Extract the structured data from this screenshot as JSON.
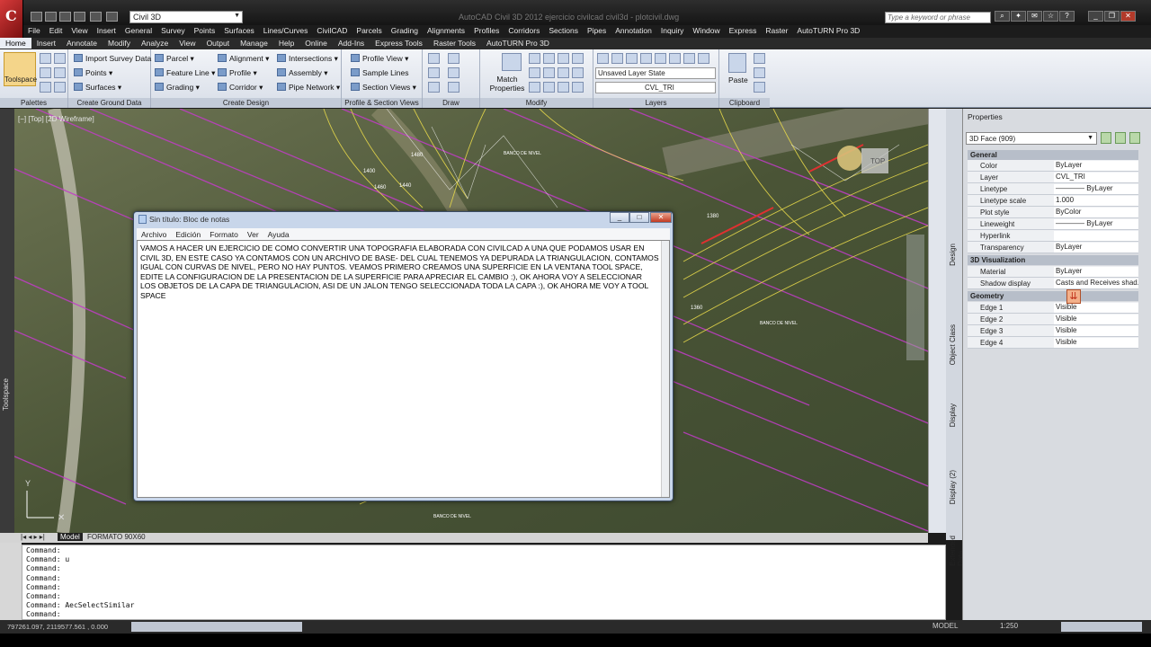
{
  "app": {
    "workspace": "Civil 3D",
    "title": "AutoCAD Civil 3D 2012    ejercicio civilcad civil3d - plotcivil.dwg",
    "search_placeholder": "Type a keyword or phrase"
  },
  "menu": [
    "File",
    "Edit",
    "View",
    "Insert",
    "General",
    "Survey",
    "Points",
    "Surfaces",
    "Lines/Curves",
    "CivilCAD",
    "Parcels",
    "Grading",
    "Alignments",
    "Profiles",
    "Corridors",
    "Sections",
    "Pipes",
    "Annotation",
    "Inquiry",
    "Window",
    "Express",
    "Raster",
    "AutoTURN Pro 3D"
  ],
  "tabs": [
    "Home",
    "Insert",
    "Annotate",
    "Modify",
    "Analyze",
    "View",
    "Output",
    "Manage",
    "Help",
    "Online",
    "Add-Ins",
    "Express Tools",
    "Raster Tools",
    "AutoTURN Pro 3D"
  ],
  "ribbon": {
    "toolspace": "Toolspace",
    "import_survey": "Import Survey Data",
    "points": "Points",
    "surfaces": "Surfaces",
    "parcel": "Parcel",
    "feature_line": "Feature Line",
    "grading": "Grading",
    "alignment": "Alignment",
    "profile": "Profile",
    "corridor": "Corridor",
    "intersections": "Intersections",
    "assembly": "Assembly",
    "pipe_network": "Pipe Network",
    "profile_view": "Profile View",
    "sample_lines": "Sample Lines",
    "section_views": "Section Views",
    "match_properties": "Match Properties",
    "layer_state": "Unsaved Layer State",
    "layer_current": "CVL_TRI",
    "paste": "Paste",
    "panels": [
      "Palettes",
      "Create Ground Data",
      "Create Design",
      "Profile & Section Views",
      "Draw",
      "Modify",
      "Layers",
      "Clipboard"
    ]
  },
  "viewport": {
    "label": "[−] [Top] [2D Wireframe]",
    "nav_top": "TOP",
    "contour_labels": [
      "1480",
      "1460",
      "1440",
      "1400",
      "1380",
      "1360"
    ],
    "level_note": "BANCO DE NIVEL"
  },
  "toolspace_label": "Toolspace",
  "model_tabs": [
    "Model",
    "FORMATO 90X60"
  ],
  "command_lines": [
    "Command:",
    "Command: u",
    "Command:",
    "Command:",
    "Command:",
    "Command:",
    "Command: AecSelectSimilar",
    "Command:"
  ],
  "status": {
    "coords": "797261.097, 2119577.561 , 0.000",
    "model": "MODEL",
    "scale": "1:250"
  },
  "palette_tabs": [
    "Design",
    "Object Class",
    "Display",
    "Display (2)",
    "Extended Data"
  ],
  "properties": {
    "title": "Properties",
    "selection": "3D Face (909)",
    "sections": [
      {
        "name": "General",
        "rows": [
          [
            "Color",
            "ByLayer"
          ],
          [
            "Layer",
            "CVL_TRI"
          ],
          [
            "Linetype",
            "———— ByLayer"
          ],
          [
            "Linetype scale",
            "1.000"
          ],
          [
            "Plot style",
            "ByColor"
          ],
          [
            "Lineweight",
            "———— ByLayer"
          ],
          [
            "Hyperlink",
            ""
          ],
          [
            "Transparency",
            "ByLayer"
          ]
        ]
      },
      {
        "name": "3D Visualization",
        "rows": [
          [
            "Material",
            "ByLayer"
          ],
          [
            "Shadow display",
            "Casts and Receives shad..."
          ]
        ]
      },
      {
        "name": "Geometry",
        "rows": [
          [
            "Edge 1",
            "Visible"
          ],
          [
            "Edge 2",
            "Visible"
          ],
          [
            "Edge 3",
            "Visible"
          ],
          [
            "Edge 4",
            "Visible"
          ]
        ]
      }
    ]
  },
  "notepad": {
    "title": "Sin título: Bloc de notas",
    "menu": [
      "Archivo",
      "Edición",
      "Formato",
      "Ver",
      "Ayuda"
    ],
    "text": "VAMOS A HACER UN EJERCICIO DE COMO CONVERTIR UNA TOPOGRAFIA ELABORADA CON CIVILCAD A UNA QUE PODAMOS USAR EN CIVIL 3D, EN ESTE CASO YA CONTAMOS CON UN ARCHIVO DE BASE- DEL CUAL TENEMOS YA DEPURADA LA TRIANGULACION, CONTAMOS IGUAL CON CURVAS DE NIVEL, PERO NO HAY PUNTOS. VEAMOS PRIMERO CREAMOS UNA SUPERFICIE EN LA VENTANA TOOL SPACE, EDITE LA CONFIGURACION DE LA PRESENTACION DE LA SUPERFICIE PARA APRECIAR EL CAMBIO :), OK AHORA VOY A SELECCIONAR LOS OBJETOS DE LA CAPA DE TRIANGULACION, ASI DE UN JALON TENGO SELECCIONADA TODA LA CAPA :), OK AHORA ME VOY A TOOL SPACE"
  },
  "colors": {
    "ribbon_bg": "#e4e8ef",
    "magenta_lines": "#c23cc8",
    "contour": "#e6d84a",
    "dark_chrome": "#1c1c1c"
  }
}
